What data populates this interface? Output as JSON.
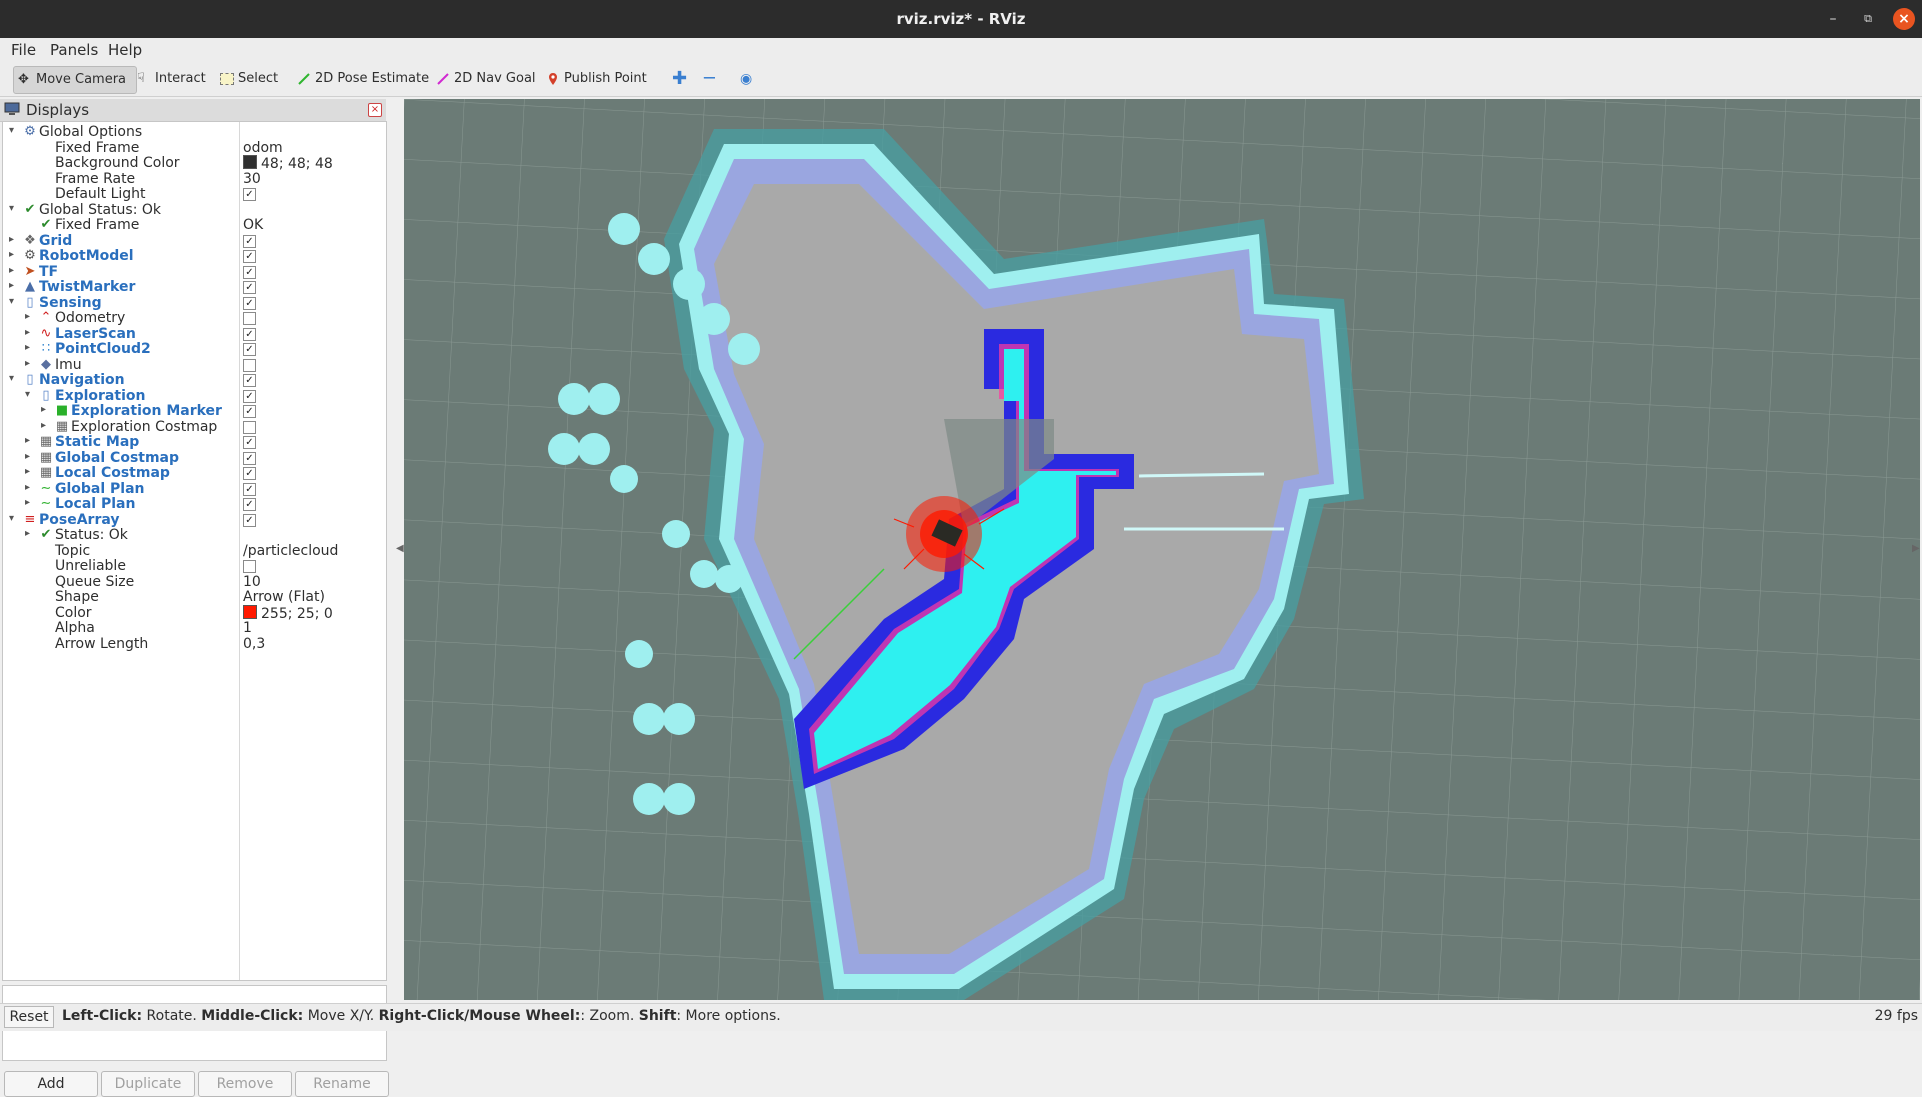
{
  "window": {
    "title": "rviz.rviz* - RViz"
  },
  "menu": [
    "File",
    "Panels",
    "Help"
  ],
  "toolbar": {
    "move_camera": "Move Camera",
    "interact": "Interact",
    "select": "Select",
    "pose_estimate": "2D Pose Estimate",
    "nav_goal": "2D Nav Goal",
    "publish_point": "Publish Point"
  },
  "displays": {
    "title": "Displays",
    "rows": [
      {
        "label": "Global Options",
        "value": "",
        "check": null,
        "indent": 0,
        "expand": "open",
        "icon": "gear",
        "link": false
      },
      {
        "label": "Fixed Frame",
        "value": "odom",
        "check": null,
        "indent": 1,
        "expand": "",
        "icon": "",
        "link": false
      },
      {
        "label": "Background Color",
        "value": "48; 48; 48",
        "swatch": "#303030",
        "check": null,
        "indent": 1,
        "expand": "",
        "icon": "",
        "link": false
      },
      {
        "label": "Frame Rate",
        "value": "30",
        "check": null,
        "indent": 1,
        "expand": "",
        "icon": "",
        "link": false
      },
      {
        "label": "Default Light",
        "value": "",
        "check": true,
        "indent": 1,
        "expand": "",
        "icon": "",
        "link": false
      },
      {
        "label": "Global Status: Ok",
        "value": "",
        "check": null,
        "indent": 0,
        "expand": "open",
        "icon": "ok",
        "link": false
      },
      {
        "label": "Fixed Frame",
        "value": "OK",
        "check": null,
        "indent": 1,
        "expand": "",
        "icon": "ok",
        "link": false
      },
      {
        "label": "Grid",
        "value": "",
        "check": true,
        "indent": 0,
        "expand": "closed",
        "icon": "grid",
        "link": true
      },
      {
        "label": "RobotModel",
        "value": "",
        "check": true,
        "indent": 0,
        "expand": "closed",
        "icon": "robot",
        "link": true
      },
      {
        "label": "TF",
        "value": "",
        "check": true,
        "indent": 0,
        "expand": "closed",
        "icon": "tf",
        "link": true
      },
      {
        "label": "TwistMarker",
        "value": "",
        "check": true,
        "indent": 0,
        "expand": "closed",
        "icon": "marker",
        "link": true
      },
      {
        "label": "Sensing",
        "value": "",
        "check": true,
        "indent": 0,
        "expand": "open",
        "icon": "folder",
        "link": true
      },
      {
        "label": "Odometry",
        "value": "",
        "check": false,
        "indent": 1,
        "expand": "closed",
        "icon": "odom",
        "link": false
      },
      {
        "label": "LaserScan",
        "value": "",
        "check": true,
        "indent": 1,
        "expand": "closed",
        "icon": "laser",
        "link": true
      },
      {
        "label": "PointCloud2",
        "value": "",
        "check": true,
        "indent": 1,
        "expand": "closed",
        "icon": "cloud",
        "link": true
      },
      {
        "label": "Imu",
        "value": "",
        "check": false,
        "indent": 1,
        "expand": "closed",
        "icon": "imu",
        "link": false
      },
      {
        "label": "Navigation",
        "value": "",
        "check": true,
        "indent": 0,
        "expand": "open",
        "icon": "folder",
        "link": true
      },
      {
        "label": "Exploration",
        "value": "",
        "check": true,
        "indent": 1,
        "expand": "open",
        "icon": "folder",
        "link": true
      },
      {
        "label": "Exploration Marker",
        "value": "",
        "check": true,
        "indent": 2,
        "expand": "closed",
        "icon": "cube",
        "link": true
      },
      {
        "label": "Exploration Costmap",
        "value": "",
        "check": false,
        "indent": 2,
        "expand": "closed",
        "icon": "map",
        "link": false
      },
      {
        "label": "Static Map",
        "value": "",
        "check": true,
        "indent": 1,
        "expand": "closed",
        "icon": "map",
        "link": true
      },
      {
        "label": "Global Costmap",
        "value": "",
        "check": true,
        "indent": 1,
        "expand": "closed",
        "icon": "map",
        "link": true
      },
      {
        "label": "Local Costmap",
        "value": "",
        "check": true,
        "indent": 1,
        "expand": "closed",
        "icon": "map",
        "link": true
      },
      {
        "label": "Global Plan",
        "value": "",
        "check": true,
        "indent": 1,
        "expand": "closed",
        "icon": "path",
        "link": true
      },
      {
        "label": "Local Plan",
        "value": "",
        "check": true,
        "indent": 1,
        "expand": "closed",
        "icon": "path",
        "link": true
      },
      {
        "label": "PoseArray",
        "value": "",
        "check": true,
        "indent": 0,
        "expand": "open",
        "icon": "posearray",
        "link": true
      },
      {
        "label": "Status: Ok",
        "value": "",
        "check": null,
        "indent": 1,
        "expand": "closed",
        "icon": "ok",
        "link": false
      },
      {
        "label": "Topic",
        "value": "/particlecloud",
        "check": null,
        "indent": 1,
        "expand": "",
        "icon": "",
        "link": false
      },
      {
        "label": "Unreliable",
        "value": "",
        "check": false,
        "indent": 1,
        "expand": "",
        "icon": "",
        "link": false
      },
      {
        "label": "Queue Size",
        "value": "10",
        "check": null,
        "indent": 1,
        "expand": "",
        "icon": "",
        "link": false
      },
      {
        "label": "Shape",
        "value": "Arrow (Flat)",
        "check": null,
        "indent": 1,
        "expand": "",
        "icon": "",
        "link": false
      },
      {
        "label": "Color",
        "value": "255; 25; 0",
        "swatch": "#ff1900",
        "check": null,
        "indent": 1,
        "expand": "",
        "icon": "",
        "link": false
      },
      {
        "label": "Alpha",
        "value": "1",
        "check": null,
        "indent": 1,
        "expand": "",
        "icon": "",
        "link": false
      },
      {
        "label": "Arrow Length",
        "value": "0,3",
        "check": null,
        "indent": 1,
        "expand": "",
        "icon": "",
        "link": false
      }
    ],
    "buttons": [
      "Add",
      "Duplicate",
      "Remove",
      "Rename"
    ]
  },
  "status": {
    "reset": "Reset",
    "hint": [
      {
        "bold": "Left-Click:",
        "text": " Rotate. "
      },
      {
        "bold": "Middle-Click:",
        "text": " Move X/Y. "
      },
      {
        "bold": "Right-Click/Mouse Wheel:",
        "text": ": Zoom. "
      },
      {
        "bold": "Shift",
        "text": ": More options."
      }
    ],
    "fps": "29 fps"
  },
  "colors": {
    "background": "#6b7b76",
    "free_space": "#a9a9a9",
    "costmap_inflation": "#9aa6e0",
    "costmap_outer": "#4a9ea0",
    "lethal_cyan": "#9fefef",
    "local_costmap_blue": "#2a2ae0",
    "particles": "#ff1900",
    "plan": "#3ad03a"
  }
}
